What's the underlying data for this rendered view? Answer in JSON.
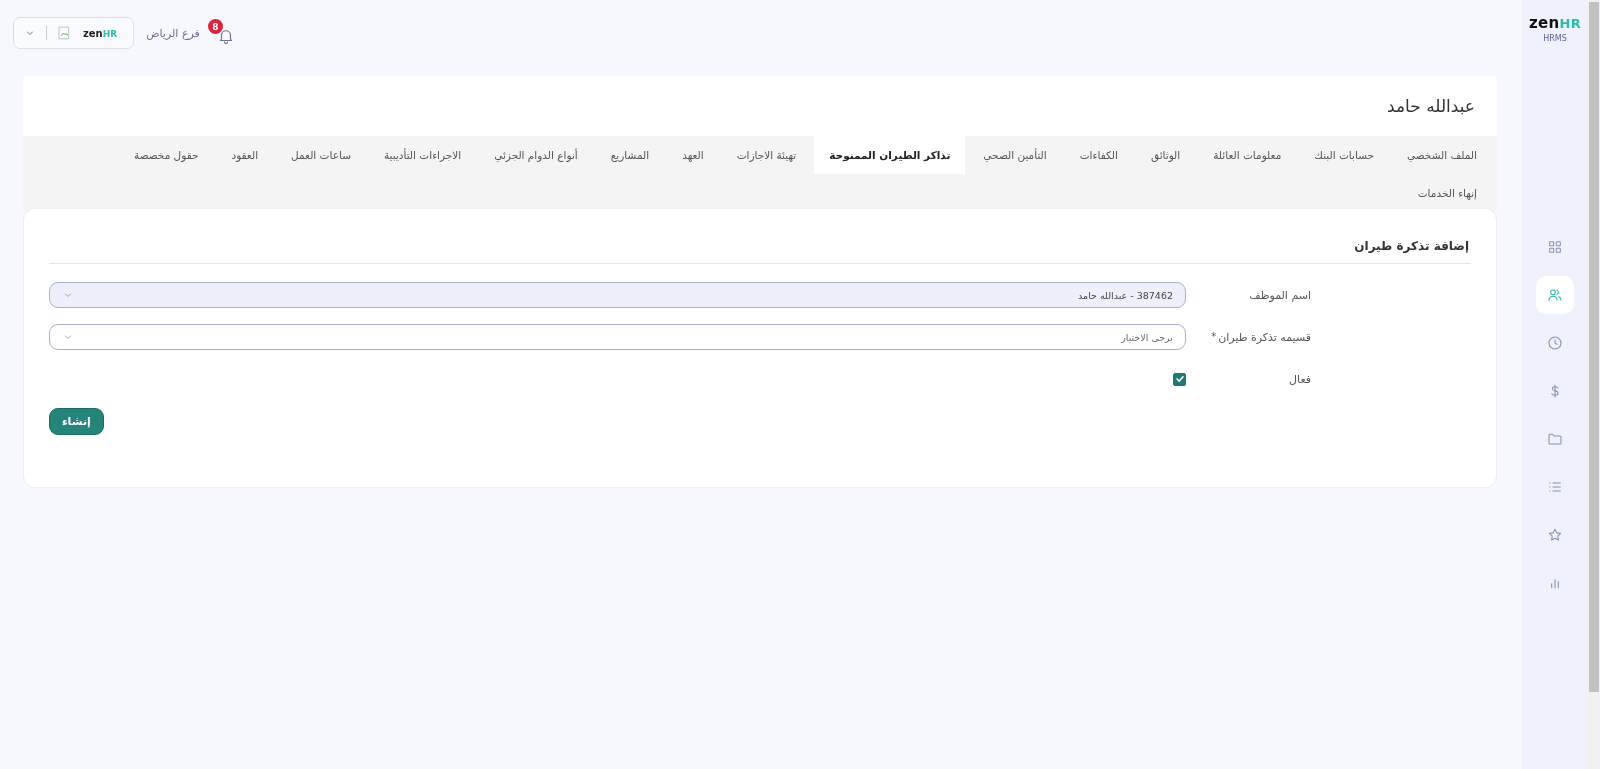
{
  "topbar": {
    "company_logo": {
      "part_1": "zen",
      "part_2": "HR"
    },
    "branch": "فرع الرياض",
    "notifications": "8"
  },
  "sidebar": {
    "logo": {
      "part_1": "zen",
      "part_2": "HR"
    },
    "product": "HRMS",
    "items": [
      {
        "selected": false
      },
      {
        "selected": true
      },
      {
        "selected": false
      },
      {
        "selected": false
      },
      {
        "selected": false
      },
      {
        "selected": false
      },
      {
        "selected": false
      },
      {
        "selected": false
      }
    ]
  },
  "employee_name": "عبدالله حامد",
  "tabs": [
    {
      "label": "الملف الشخصي",
      "selected": false
    },
    {
      "label": "حسابات البنك",
      "selected": false
    },
    {
      "label": "معلومات العائلة",
      "selected": false
    },
    {
      "label": "الوثائق",
      "selected": false
    },
    {
      "label": "الكفاءات",
      "selected": false
    },
    {
      "label": "التأمين الصحي",
      "selected": false
    },
    {
      "label": "تذاكر الطيران الممنوحة",
      "selected": true
    },
    {
      "label": "تهيئة الاجازات",
      "selected": false
    },
    {
      "label": "العهد",
      "selected": false
    },
    {
      "label": "المشاريع",
      "selected": false
    },
    {
      "label": "أنواع الدوام الجزئي",
      "selected": false
    },
    {
      "label": "الاجراءات التأديبية",
      "selected": false
    },
    {
      "label": "ساعات العمل",
      "selected": false
    },
    {
      "label": "العقود",
      "selected": false
    },
    {
      "label": "حقول مخصصة",
      "selected": false
    },
    {
      "label": "إنهاء الخدمات",
      "selected": false
    }
  ],
  "form": {
    "title": "إضافة تذكرة طيران",
    "fields": [
      {
        "kind": "select",
        "label": "اسم الموظف",
        "value": "387462 - عبدالله حامد",
        "disabled": true
      },
      {
        "kind": "select",
        "label": "قسيمه تذكرة طيران",
        "required": "*",
        "placeholder": "يرجى الاختيار",
        "disabled": false
      },
      {
        "kind": "checkbox",
        "label": "فعال",
        "checked": true
      }
    ],
    "submit": "إنشاء"
  }
}
